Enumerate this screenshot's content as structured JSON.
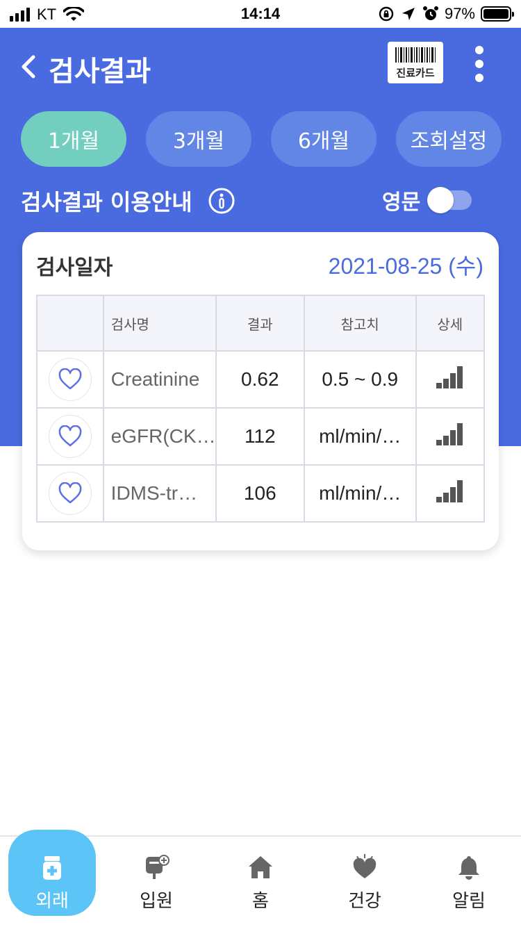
{
  "status_bar": {
    "carrier": "KT",
    "time": "14:14",
    "battery_percent": "97%"
  },
  "header": {
    "title": "검사결과",
    "card_button_label": "진료카드"
  },
  "tabs": [
    {
      "label": "1개월",
      "active": true
    },
    {
      "label": "3개월",
      "active": false
    },
    {
      "label": "6개월",
      "active": false
    },
    {
      "label": "조회설정",
      "active": false
    }
  ],
  "guide": {
    "text": "검사결과 이용안내",
    "lang_label": "영문",
    "lang_toggle_on": false
  },
  "card": {
    "date_label": "검사일자",
    "date_value": "2021-08-25 (수)",
    "columns": [
      "",
      "검사명",
      "결과",
      "참고치",
      "상세"
    ],
    "rows": [
      {
        "name": "Creatinine",
        "result": "0.62",
        "reference": "0.5 ~ 0.9"
      },
      {
        "name": "eGFR(CK…",
        "result": "112",
        "reference": "ml/min/…"
      },
      {
        "name": "IDMS-tr…",
        "result": "106",
        "reference": "ml/min/…"
      }
    ]
  },
  "bottom_nav": [
    {
      "label": "외래",
      "icon": "medicine-bottle-icon",
      "active": true
    },
    {
      "label": "입원",
      "icon": "iv-bag-icon",
      "active": false
    },
    {
      "label": "홈",
      "icon": "home-icon",
      "active": false
    },
    {
      "label": "건강",
      "icon": "heart-icon",
      "active": false
    },
    {
      "label": "알림",
      "icon": "bell-icon",
      "active": false
    }
  ],
  "colors": {
    "primary_blue": "#4a6be0",
    "active_tab": "#72cfc0",
    "inactive_tab": "#6186e6",
    "date_text": "#4a6be0",
    "nav_active": "#5dc4f7"
  }
}
